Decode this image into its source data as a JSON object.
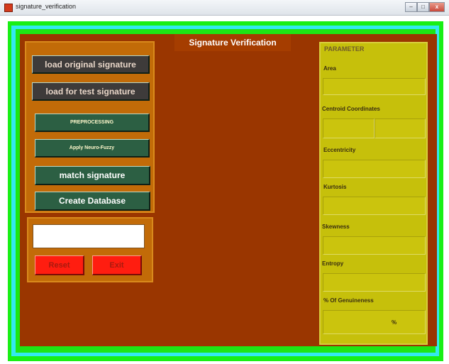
{
  "window": {
    "title": "signature_verification",
    "controls": {
      "minimize": "–",
      "maximize": "□",
      "close": "x"
    }
  },
  "header": {
    "title": "Signature Verification"
  },
  "actions": {
    "load_original": "load original signature",
    "load_test": "load for test signature",
    "preprocessing": "PREPROCESSING",
    "neuro_fuzzy": "Apply Neuro-Fuzzy",
    "match": "match signature",
    "create_database": "Create Database"
  },
  "result": {
    "text": "",
    "reset": "Reset",
    "exit": "Exit"
  },
  "parameters": {
    "title": "PARAMETER",
    "area": {
      "label": "Area",
      "value": ""
    },
    "centroid": {
      "label": "Centroid Coordinates",
      "x": "",
      "y": ""
    },
    "eccentricity": {
      "label": "Eccentricity",
      "value": ""
    },
    "kurtosis": {
      "label": "Kurtosis",
      "value": ""
    },
    "skewness": {
      "label": "Skewness",
      "value": ""
    },
    "entropy": {
      "label": "Entropy",
      "value": ""
    },
    "genuineness": {
      "label": "% Of Genuineness",
      "value": "",
      "unit": "%"
    }
  },
  "colors": {
    "main_background": "#9a3600",
    "button_panel": "#c26b08",
    "parameter_panel": "#c6c00b",
    "frame_green": "#19ef15",
    "frame_cyan": "#33e9ef",
    "button_red": "#ff1d10"
  }
}
